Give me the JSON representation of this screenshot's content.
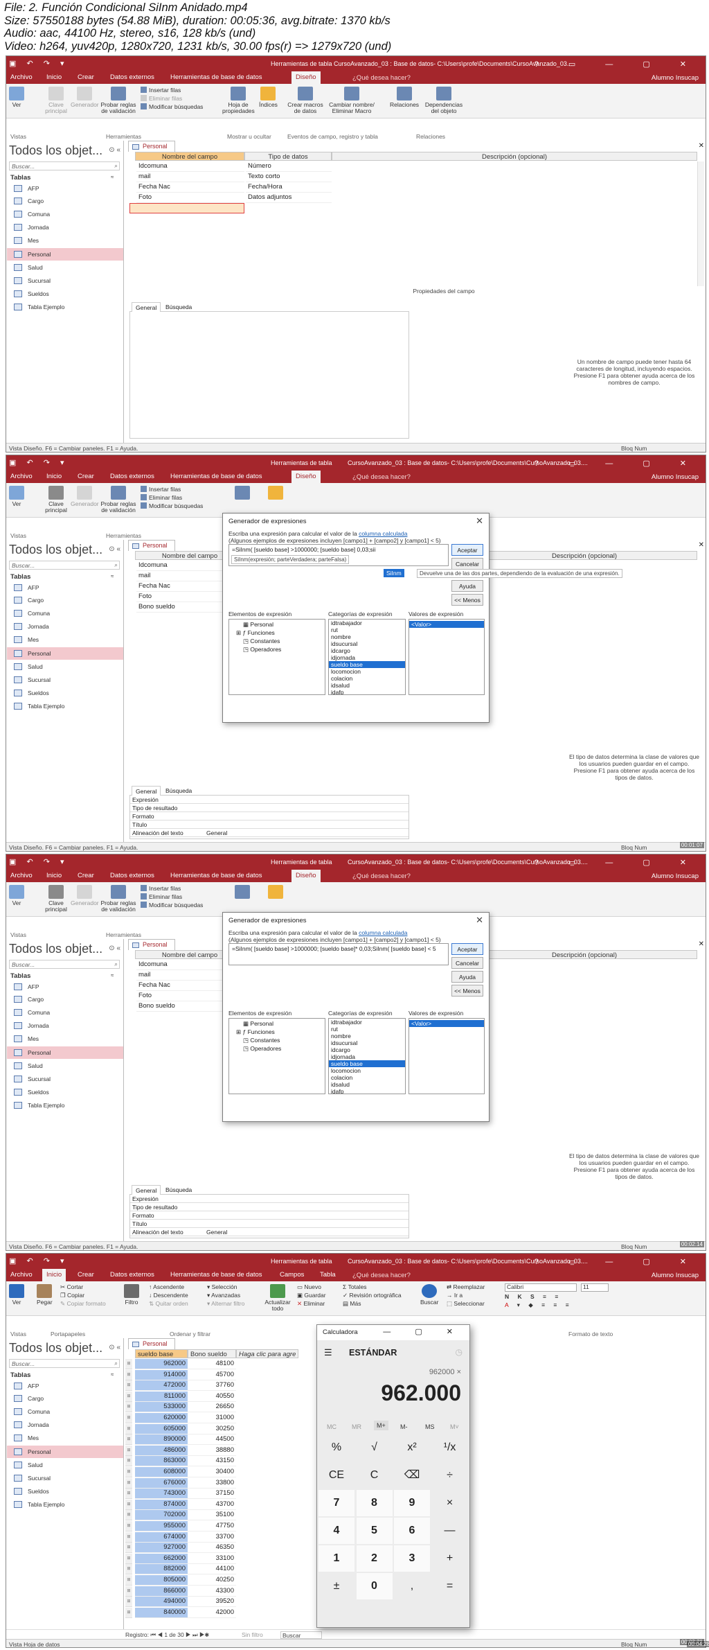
{
  "file_info": {
    "line1": "File: 2. Función Condicional SiInm Anidado.mp4",
    "line2": "Size: 57550188 bytes (54.88 MiB), duration: 00:05:36, avg.bitrate: 1370 kb/s",
    "line3": "Audio: aac, 44100 Hz, stereo, s16, 128 kb/s (und)",
    "line4": "Video: h264, yuv420p, 1280x720, 1231 kb/s, 30.00 fps(r) => 1279x720 (und)"
  },
  "common": {
    "tabs": [
      "Archivo",
      "Inicio",
      "Crear",
      "Datos externos",
      "Herramientas de base de datos"
    ],
    "tools_label": "Herramientas de tabla",
    "design_tab": "Diseño",
    "tell_me": "¿Qué desea hacer?",
    "user": "Alumno Insucap",
    "nav_title": "Todos los objet...",
    "nav_search": "Buscar...",
    "nav_group": "Tablas",
    "nav_items": [
      "AFP",
      "Cargo",
      "Comuna",
      "Jornada",
      "Mes",
      "Personal",
      "Salud",
      "Sucursal",
      "Sueldos",
      "Tabla Ejemplo"
    ],
    "doc_tab": "Personal",
    "status_design": "Vista Diseño.  F6 = Cambiar paneles.  F1 = Ayuda.",
    "status_right": "Bloq Num",
    "ribbon_design": {
      "ver": "Ver",
      "clave": "Clave principal",
      "generador": "Generador",
      "probar": "Probar reglas de validación",
      "insertar": "Insertar filas",
      "eliminar": "Eliminar filas",
      "modificar": "Modificar búsquedas",
      "hoja": "Hoja de propiedades",
      "indices": "Índices",
      "crear_macros": "Crear macros de datos",
      "cambiar": "Cambiar nombre/ Eliminar Macro",
      "relaciones": "Relaciones",
      "dependencias": "Dependencias del objeto",
      "g_vistas": "Vistas",
      "g_herr": "Herramientas",
      "g_mostrar": "Mostrar u ocultar",
      "g_eventos": "Eventos de campo, registro y tabla",
      "g_rel": "Relaciones"
    },
    "grid_headers": [
      "Nombre del campo",
      "Tipo de datos",
      "Descripción (opcional)"
    ],
    "prop_tabs": [
      "General",
      "Búsqueda"
    ]
  },
  "frame1": {
    "title": "Herramientas de tabla    CursoAvanzado_03 : Base de datos- C:\\Users\\profe\\Documents\\CursoAvanzado_03....",
    "fields": [
      {
        "name": "Idcomuna",
        "type": "Número"
      },
      {
        "name": "mail",
        "type": "Texto corto"
      },
      {
        "name": "Fecha Nac",
        "type": "Fecha/Hora"
      },
      {
        "name": "Foto",
        "type": "Datos adjuntos"
      }
    ],
    "props_title": "Propiedades del campo",
    "hint": "Un nombre de campo puede tener hasta 64 caracteres de longitud, incluyendo espacios. Presione F1 para obtener ayuda acerca de los nombres de campo."
  },
  "frame2": {
    "title": "CursoAvanzado_03 : Base de datos- C:\\Users\\profe\\Documents\\CursoAvanzado_03....",
    "fields": [
      "Idcomuna",
      "mail",
      "Fecha Nac",
      "Foto",
      "Bono sueldo"
    ],
    "props": [
      {
        "k": "Expresión",
        "v": ""
      },
      {
        "k": "Tipo de resultado",
        "v": ""
      },
      {
        "k": "Formato",
        "v": ""
      },
      {
        "k": "Título",
        "v": ""
      },
      {
        "k": "Alineación del texto",
        "v": "General"
      }
    ],
    "hint": "El tipo de datos determina la clase de valores que los usuarios pueden guardar en el campo. Presione F1 para obtener ayuda acerca de los tipos de datos.",
    "dialog": {
      "title": "Generador de expresiones",
      "desc1": "Escriba una expresión para calcular el valor de la",
      "desc_link": "columna calculada",
      "desc2": "(Algunos ejemplos de expresiones incluyen [campo1] + [campo2] y [campo1] < 5)",
      "expr": "=SiInm( [sueldo base] >1000000; [sueldo base] 0,03;sii",
      "tooltip": "SiInm(expresión; parteVerdadera; parteFalsa)",
      "autocomplete": "SiInm",
      "desc_popup": "Devuelve una de las dos partes, dependiendo de la evaluación de una expresión.",
      "buttons": [
        "Aceptar",
        "Cancelar",
        "Ayuda",
        "<< Menos"
      ],
      "col_labels": [
        "Elementos de expresión",
        "Categorías de expresión",
        "Valores de expresión"
      ],
      "elements": [
        "Personal",
        "Funciones",
        "Constantes",
        "Operadores"
      ],
      "categories": [
        "idtrabajador",
        "rut",
        "nombre",
        "idsucursal",
        "idcargo",
        "idjornada",
        "sueldo base",
        "locomocion",
        "colacion",
        "idsalud",
        "idafp"
      ],
      "values": [
        "<Valor>"
      ]
    }
  },
  "frame3": {
    "expr": "=SiInm( [sueldo base] >1000000; [sueldo base]* 0,03;SiInm( [sueldo base] < 5"
  },
  "frame4": {
    "title": "CursoAvanzado_03 : Base de datos- C:\\Users\\profe\\Documents\\CursoAvanzado_03....",
    "tabs_extra": [
      "Campos",
      "Tabla"
    ],
    "ribbon": {
      "ver": "Ver",
      "pegar": "Pegar",
      "cortar": "Cortar",
      "copiar": "Copiar",
      "copiar_formato": "Copiar formato",
      "filtro": "Filtro",
      "asc": "Ascendente",
      "desc": "Descendente",
      "quitar": "Quitar orden",
      "seleccion": "Selección",
      "avanzadas": "Avanzadas",
      "alternar": "Alternar filtro",
      "actualizar": "Actualizar todo",
      "nuevo": "Nuevo",
      "guardar": "Guardar",
      "eliminar": "Eliminar",
      "totales": "Totales",
      "ortografia": "Revisión ortográfica",
      "mas": "Más",
      "buscar": "Buscar",
      "reemplazar": "Reemplazar",
      "ir_a": "Ir a",
      "seleccionar": "Seleccionar",
      "font": "Calibri",
      "size": "11",
      "g_vistas": "Vistas",
      "g_porta": "Portapapeles",
      "g_orden": "Ordenar y filtrar",
      "g_formato": "Formato de texto"
    },
    "col_headers": [
      "sueldo base",
      "Bono sueldo",
      "Haga clic para agre"
    ],
    "rows": [
      [
        "962000",
        "48100"
      ],
      [
        "914000",
        "45700"
      ],
      [
        "472000",
        "37760"
      ],
      [
        "811000",
        "40550"
      ],
      [
        "533000",
        "26650"
      ],
      [
        "620000",
        "31000"
      ],
      [
        "605000",
        "30250"
      ],
      [
        "890000",
        "44500"
      ],
      [
        "486000",
        "38880"
      ],
      [
        "863000",
        "43150"
      ],
      [
        "608000",
        "30400"
      ],
      [
        "676000",
        "33800"
      ],
      [
        "743000",
        "37150"
      ],
      [
        "874000",
        "43700"
      ],
      [
        "702000",
        "35100"
      ],
      [
        "955000",
        "47750"
      ],
      [
        "674000",
        "33700"
      ],
      [
        "927000",
        "46350"
      ],
      [
        "662000",
        "33100"
      ],
      [
        "882000",
        "44100"
      ],
      [
        "805000",
        "40250"
      ],
      [
        "866000",
        "43300"
      ],
      [
        "494000",
        "39520"
      ],
      [
        "840000",
        "42000"
      ]
    ],
    "record_nav": "Registro:  ⏮  ◀  1 de 30   ▶  ⏭  ▶✱",
    "no_filter": "Sin filtro",
    "search": "Buscar",
    "status_left": "Vista Hoja de datos",
    "calculator": {
      "title": "Calculadora",
      "mode": "ESTÁNDAR",
      "history": "962000 ×",
      "display": "962.000",
      "memory": [
        "MC",
        "MR",
        "M+",
        "M-",
        "MS",
        "M˅"
      ],
      "keys": [
        "%",
        "√",
        "x²",
        "¹/x",
        "CE",
        "C",
        "⌫",
        "÷",
        "7",
        "8",
        "9",
        "×",
        "4",
        "5",
        "6",
        "—",
        "1",
        "2",
        "3",
        "+",
        "±",
        "0",
        ",",
        "="
      ]
    }
  },
  "timestamps": [
    "00:01:07",
    "00:02:14",
    "00:03:21",
    "00:04:28"
  ]
}
